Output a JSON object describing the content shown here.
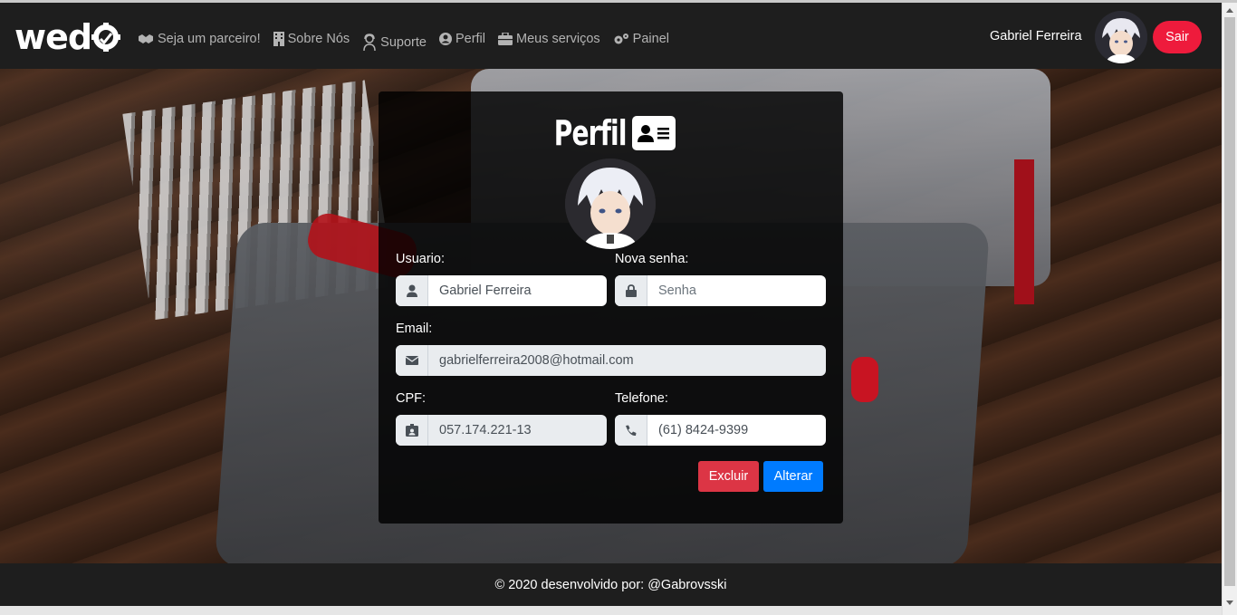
{
  "nav": {
    "logo": "wedo",
    "items": [
      {
        "label": "Seja um parceiro!",
        "icon": "handshake-icon"
      },
      {
        "label": "Sobre Nós",
        "icon": "building-icon"
      },
      {
        "label": "Suporte",
        "icon": "support-agent-icon"
      },
      {
        "label": "Perfil",
        "icon": "user-circle-icon"
      },
      {
        "label": "Meus serviços",
        "icon": "briefcase-icon"
      },
      {
        "label": "Painel",
        "icon": "gears-icon"
      }
    ],
    "user_name": "Gabriel Ferreira",
    "logout_label": "Sair"
  },
  "card": {
    "title": "Perfil",
    "title_icon": "id-card-icon",
    "fields": {
      "usuario": {
        "label": "Usuario:",
        "value": "Gabriel Ferreira",
        "icon": "user-icon"
      },
      "senha": {
        "label": "Nova senha:",
        "placeholder": "Senha",
        "icon": "lock-icon"
      },
      "email": {
        "label": "Email:",
        "value": "gabrielferreira2008@hotmail.com",
        "icon": "envelope-icon"
      },
      "cpf": {
        "label": "CPF:",
        "value": "057.174.221-13",
        "icon": "id-badge-icon"
      },
      "telefone": {
        "label": "Telefone:",
        "value": "(61) 8424-9399",
        "icon": "phone-icon"
      }
    },
    "buttons": {
      "delete": "Excluir",
      "update": "Alterar"
    }
  },
  "footer": {
    "text": "© 2020 desenvolvido por: @Gabrovsski"
  },
  "colors": {
    "navbar_bg": "#1e1e1e",
    "logout_button": "#ee1b3c",
    "delete_button": "#dc3545",
    "update_button": "#007bff",
    "nav_text": "#b3b3b3"
  }
}
